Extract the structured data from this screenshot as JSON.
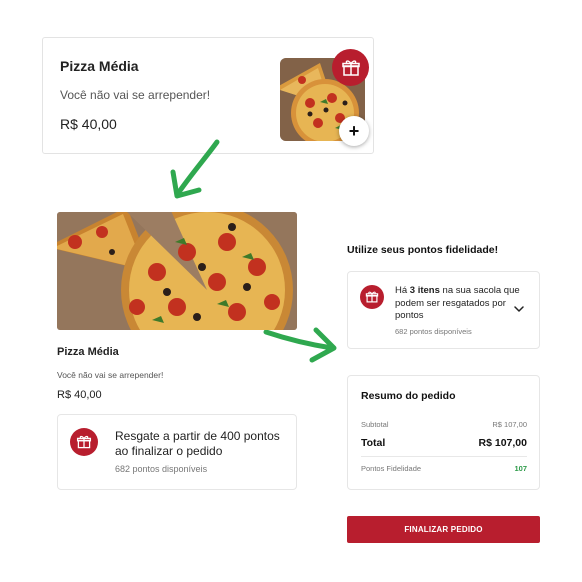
{
  "product_card": {
    "title": "Pizza Média",
    "description": "Você não vai se arrepender!",
    "price": "R$ 40,00",
    "add_label": "+"
  },
  "product_detail": {
    "title": "Pizza Média",
    "description": "Você não vai se arrepender!",
    "price": "R$ 40,00"
  },
  "redeem_card": {
    "text": "Resgate a partir de 400 pontos ao finalizar o pedido",
    "points_available": "682 pontos disponíveis"
  },
  "loyalty": {
    "heading": "Utilize seus pontos fidelidade!",
    "text_prefix": "Há ",
    "item_count": "3 itens",
    "text_suffix": " na sua sacola que podem ser resgatados por pontos",
    "points_available": "682 pontos disponíveis"
  },
  "order_summary": {
    "heading": "Resumo do pedido",
    "subtotal_label": "Subtotal",
    "subtotal_value": "R$ 107,00",
    "total_label": "Total",
    "total_value": "R$ 107,00",
    "points_label": "Pontos Fidelidade",
    "points_value": "107"
  },
  "checkout_button": "FINALIZAR PEDIDO",
  "icons": {
    "gift": "gift-icon",
    "plus": "plus-icon",
    "chevron": "chevron-down-icon",
    "arrow": "green-arrow-icon"
  },
  "colors": {
    "brand_red": "#b81e2e",
    "arrow_green": "#2fa84f",
    "points_green": "#2e9b4a"
  }
}
